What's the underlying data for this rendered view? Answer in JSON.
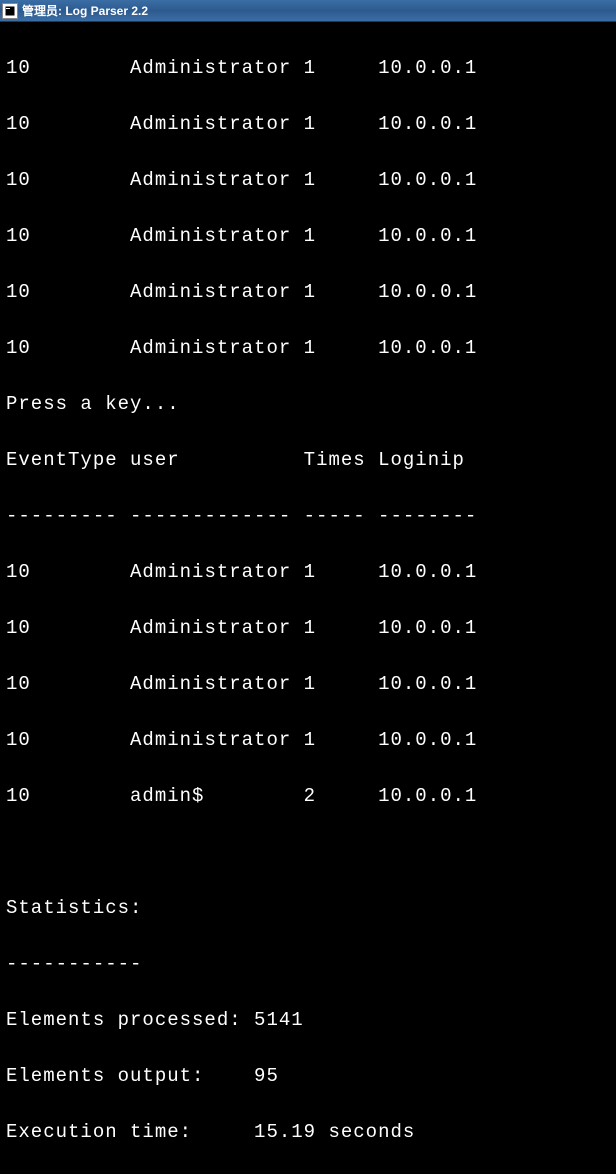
{
  "titlebar": {
    "text": "管理员: Log Parser 2.2"
  },
  "rows_top": [
    {
      "event": "10",
      "user": "Administrator",
      "times": "1",
      "ip": "10.0.0.1"
    },
    {
      "event": "10",
      "user": "Administrator",
      "times": "1",
      "ip": "10.0.0.1"
    },
    {
      "event": "10",
      "user": "Administrator",
      "times": "1",
      "ip": "10.0.0.1"
    },
    {
      "event": "10",
      "user": "Administrator",
      "times": "1",
      "ip": "10.0.0.1"
    },
    {
      "event": "10",
      "user": "Administrator",
      "times": "1",
      "ip": "10.0.0.1"
    },
    {
      "event": "10",
      "user": "Administrator",
      "times": "1",
      "ip": "10.0.0.1"
    }
  ],
  "prompt": "Press a key...",
  "headers": {
    "event": "EventType",
    "user": "user",
    "times": "Times",
    "ip": "Loginip"
  },
  "divider": "--------- ------------- ----- --------",
  "rows_bottom": [
    {
      "event": "10",
      "user": "Administrator",
      "times": "1",
      "ip": "10.0.0.1"
    },
    {
      "event": "10",
      "user": "Administrator",
      "times": "1",
      "ip": "10.0.0.1"
    },
    {
      "event": "10",
      "user": "Administrator",
      "times": "1",
      "ip": "10.0.0.1"
    },
    {
      "event": "10",
      "user": "Administrator",
      "times": "1",
      "ip": "10.0.0.1"
    },
    {
      "event": "10",
      "user": "admin$",
      "times": "2",
      "ip": "10.0.0.1"
    }
  ],
  "stats": {
    "title": "Statistics:",
    "divider": "-----------",
    "processed_label": "Elements processed:",
    "processed_value": "5141",
    "output_label": "Elements output:",
    "output_value": "95",
    "time_label": "Execution time:",
    "time_value": "15.19 seconds"
  }
}
